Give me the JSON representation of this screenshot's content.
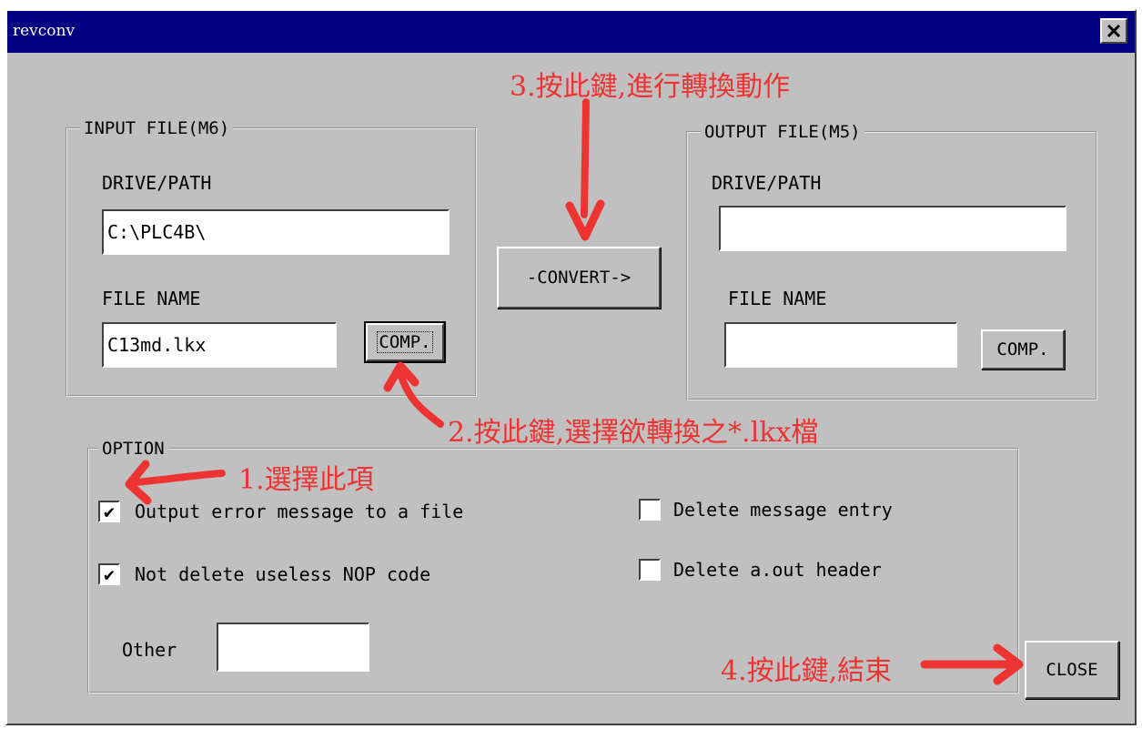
{
  "window": {
    "title": "revconv"
  },
  "input_group": {
    "legend": "INPUT FILE(M6)",
    "path_label": "DRIVE/PATH",
    "path_value": "C:\\PLC4B\\",
    "file_label": "FILE NAME",
    "file_value": "C13md.lkx",
    "comp_label": "COMP."
  },
  "convert": {
    "label": "-CONVERT->"
  },
  "output_group": {
    "legend": "OUTPUT FILE(M5)",
    "path_label": "DRIVE/PATH",
    "path_value": "",
    "file_label": "FILE NAME",
    "file_value": "",
    "comp_label": "COMP."
  },
  "options": {
    "legend": "OPTION",
    "items": [
      {
        "label": "Output error message to a file",
        "checked": true
      },
      {
        "label": "Not delete useless NOP code",
        "checked": true
      },
      {
        "label": "Delete message entry",
        "checked": false
      },
      {
        "label": "Delete a.out header",
        "checked": false
      }
    ],
    "other_label": "Other",
    "other_value": "",
    "check_mark": "✔"
  },
  "close": {
    "label": "CLOSE"
  },
  "annotations": {
    "step1": "1.選擇此項",
    "step2": "2.按此鍵,選擇欲轉換之*.lkx檔",
    "step3": "3.按此鍵,進行轉換動作",
    "step4": "4.按此鍵,結束",
    "color": "#ee3333"
  }
}
